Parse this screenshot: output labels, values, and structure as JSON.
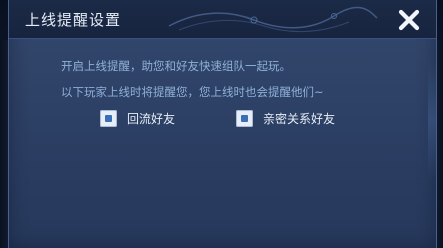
{
  "dialog": {
    "title": "上线提醒设置",
    "description_line1": "开启上线提醒，助您和好友快速组队一起玩。",
    "description_line2": "以下玩家上线时将提醒您，您上线时也会提醒他们~",
    "options": [
      {
        "label": "回流好友",
        "checked": true
      },
      {
        "label": "亲密关系好友",
        "checked": true
      }
    ]
  },
  "colors": {
    "panel": "#2d4065",
    "title_bar": "#1b2a46",
    "description_text": "#8fb0d8",
    "label_text": "#e8eef8",
    "checkbox_mark": "#3a6fb8"
  },
  "icons": {
    "close": "close-icon",
    "checkbox": "checkbox-icon"
  }
}
